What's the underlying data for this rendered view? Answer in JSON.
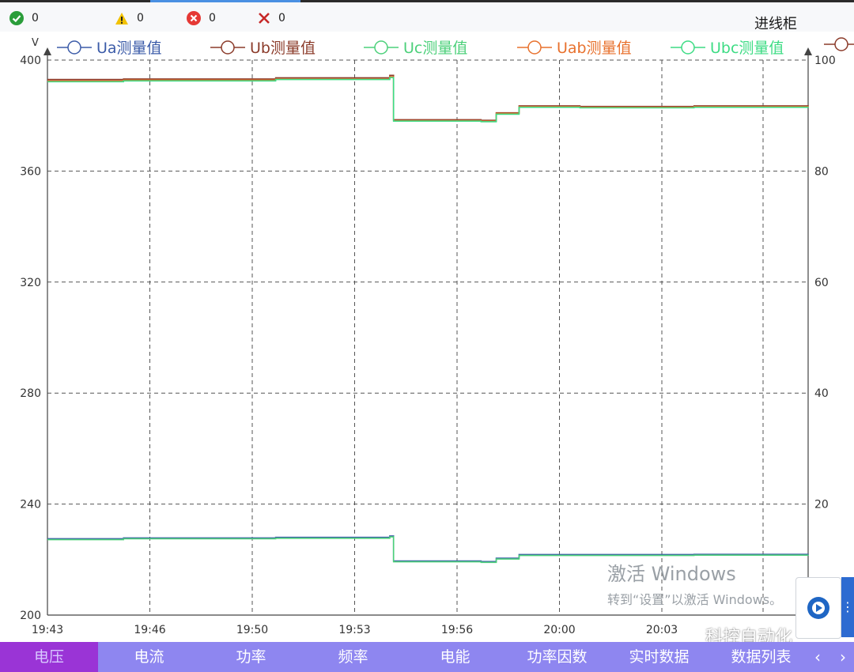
{
  "status": {
    "ok_count": "0",
    "warning_count": "0",
    "error_count": "0",
    "fault_count": "0",
    "cabinet_name": "进线柜"
  },
  "colors": {
    "ok": "#2a9d3a",
    "warning": "#f2c200",
    "error": "#e53935",
    "fault": "#c62828",
    "tab_bar": "#8e86f0",
    "tab_active": "#9a34d6"
  },
  "chart_data": {
    "type": "line",
    "y_unit": "V",
    "ylim": [
      200,
      410
    ],
    "y_ticks": [
      "400",
      "360",
      "320",
      "280",
      "240",
      "200"
    ],
    "y2lim": [
      0,
      100
    ],
    "y2_ticks": [
      "100",
      "80",
      "60",
      "40",
      "20"
    ],
    "x_ticks": [
      "19:43",
      "19:46",
      "19:50",
      "19:53",
      "19:56",
      "20:00",
      "20:03"
    ],
    "grid": true,
    "series": [
      {
        "name": "Ua测量值",
        "color": "#3b5ba8",
        "x": [
          0,
          0.1,
          0.3,
          0.45,
          0.455,
          0.57,
          0.59,
          0.62,
          0.7,
          0.85,
          1.0
        ],
        "values": [
          227.5,
          227.8,
          228.0,
          228.5,
          219.5,
          219.3,
          220.5,
          221.8,
          221.8,
          221.9,
          222.0
        ]
      },
      {
        "name": "Ub测量值",
        "color": "#8b3b2a",
        "x": [
          0,
          0.1,
          0.3,
          0.45,
          0.455,
          0.57,
          0.59,
          0.62,
          0.7,
          0.85,
          1.0
        ],
        "values": [
          393.0,
          393.2,
          393.6,
          394.5,
          378.5,
          378.3,
          381.0,
          383.5,
          383.3,
          383.5,
          383.3
        ]
      },
      {
        "name": "Uc测量值",
        "color": "#4cd07a",
        "x": [
          0,
          0.1,
          0.3,
          0.45,
          0.455,
          0.57,
          0.59,
          0.62,
          0.7,
          0.85,
          1.0
        ],
        "values": [
          227.2,
          227.5,
          227.7,
          228.2,
          219.2,
          219.0,
          220.2,
          221.5,
          221.5,
          221.6,
          221.7
        ]
      },
      {
        "name": "Uab测量值",
        "color": "#e8712d",
        "x": [
          0,
          0.1,
          0.3,
          0.45,
          0.455,
          0.57,
          0.59,
          0.62,
          0.7,
          0.85,
          1.0
        ],
        "values": [
          392.5,
          392.8,
          393.2,
          394.0,
          378.2,
          378.0,
          380.8,
          383.2,
          383.0,
          383.2,
          383.0
        ]
      },
      {
        "name": "Ubc测量值",
        "color": "#3ddc84",
        "x": [
          0,
          0.1,
          0.3,
          0.45,
          0.455,
          0.57,
          0.59,
          0.62,
          0.7,
          0.85,
          1.0
        ],
        "values": [
          392.2,
          392.5,
          393.0,
          393.7,
          378.0,
          377.8,
          380.5,
          383.0,
          382.8,
          383.0,
          382.8
        ]
      }
    ]
  },
  "watermark": {
    "line1": "激活 Windows",
    "line2": "转到“设置”以激活 Windows。"
  },
  "brand": {
    "text": "科控自动化"
  },
  "tabs": [
    {
      "label": "电压"
    },
    {
      "label": "电流"
    },
    {
      "label": "功率"
    },
    {
      "label": "频率"
    },
    {
      "label": "电能"
    },
    {
      "label": "功率因数"
    },
    {
      "label": "实时数据"
    },
    {
      "label": "数据列表"
    }
  ],
  "nav": {
    "prev_label": "‹",
    "next_label": "›"
  }
}
